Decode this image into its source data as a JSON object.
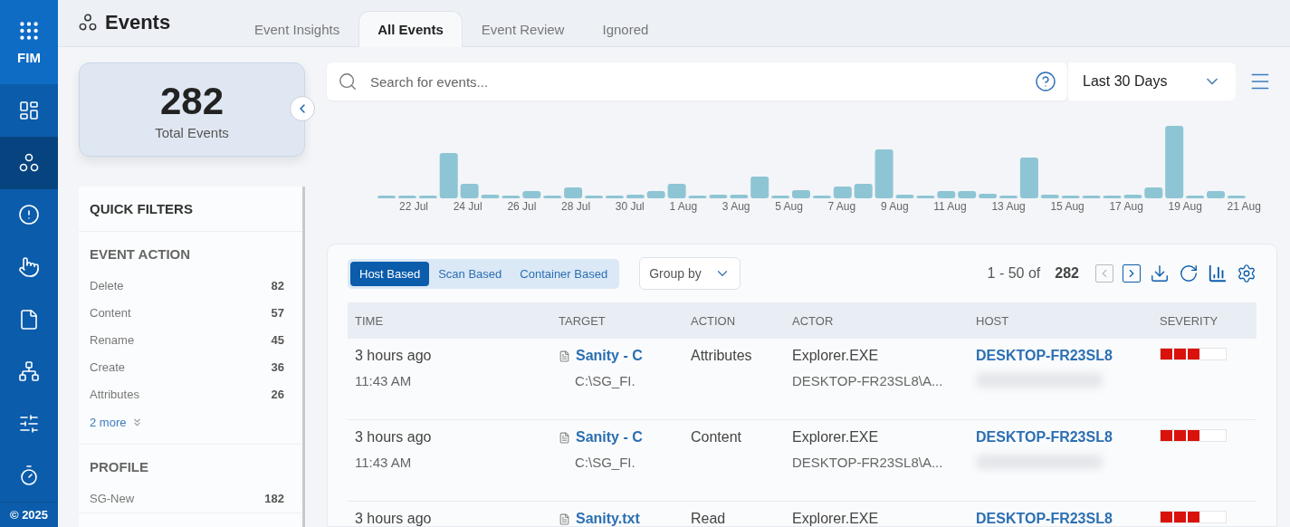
{
  "nav": {
    "brand": "FIM",
    "items": [
      {
        "kind": "dashboard",
        "selected": false
      },
      {
        "kind": "events",
        "selected": true
      },
      {
        "kind": "alert",
        "selected": false
      },
      {
        "kind": "pointer",
        "selected": false
      },
      {
        "kind": "file",
        "selected": false
      },
      {
        "kind": "network",
        "selected": false
      },
      {
        "kind": "sliders",
        "selected": false
      },
      {
        "kind": "timer",
        "selected": false
      }
    ],
    "footer": "© 2025"
  },
  "header": {
    "title": "Events",
    "tabs": [
      {
        "label": "Event Insights",
        "selected": false
      },
      {
        "label": "All Events",
        "selected": true
      },
      {
        "label": "Event Review",
        "selected": false
      },
      {
        "label": "Ignored",
        "selected": false
      }
    ]
  },
  "summary": {
    "count": "282",
    "label": "Total Events"
  },
  "quick_filters": {
    "title": "QUICK FILTERS",
    "sections": [
      {
        "title": "EVENT ACTION",
        "items": [
          {
            "label": "Delete",
            "count": "82"
          },
          {
            "label": "Content",
            "count": "57"
          },
          {
            "label": "Rename",
            "count": "45"
          },
          {
            "label": "Create",
            "count": "36"
          },
          {
            "label": "Attributes",
            "count": "26"
          }
        ],
        "more": "2 more"
      },
      {
        "title": "PROFILE",
        "items": [
          {
            "label": "SG-New",
            "count": "182"
          }
        ]
      }
    ]
  },
  "search": {
    "placeholder": "Search for events...",
    "range": "Last 30 Days"
  },
  "timeline_labels": [
    "22 Jul",
    "24 Jul",
    "26 Jul",
    "28 Jul",
    "30 Jul",
    "1 Aug",
    "3 Aug",
    "5 Aug",
    "7 Aug",
    "9 Aug",
    "11 Aug",
    "13 Aug",
    "15 Aug",
    "17 Aug",
    "19 Aug",
    "21 Aug"
  ],
  "toolbar": {
    "segments": [
      {
        "label": "Host Based",
        "selected": true
      },
      {
        "label": "Scan Based",
        "selected": false
      },
      {
        "label": "Container Based",
        "selected": false
      }
    ],
    "group_by": "Group by",
    "range": "1 - 50 of",
    "total": "282"
  },
  "table": {
    "columns": [
      "TIME",
      "TARGET",
      "ACTION",
      "ACTOR",
      "HOST",
      "SEVERITY"
    ],
    "rows": [
      {
        "time": "3 hours ago",
        "clock": "11:43 AM",
        "target": "Sanity - C",
        "path": "C:\\SG_FI.",
        "action": "Attributes",
        "actor": "Explorer.EXE",
        "actor_detail": "DESKTOP-FR23SL8\\A...",
        "host": "DESKTOP-FR23SL8",
        "level": 0.6
      },
      {
        "time": "3 hours ago",
        "clock": "11:43 AM",
        "target": "Sanity - C",
        "path": "C:\\SG_FI.",
        "action": "Content",
        "actor": "Explorer.EXE",
        "actor_detail": "DESKTOP-FR23SL8\\A...",
        "host": "DESKTOP-FR23SL8",
        "level": 0.6
      },
      {
        "time": "3 hours ago",
        "target": "Sanity.txt",
        "action": "Read",
        "actor": "Explorer.EXE",
        "host": "DESKTOP-FR23SL8",
        "level": 0.6
      }
    ]
  }
}
